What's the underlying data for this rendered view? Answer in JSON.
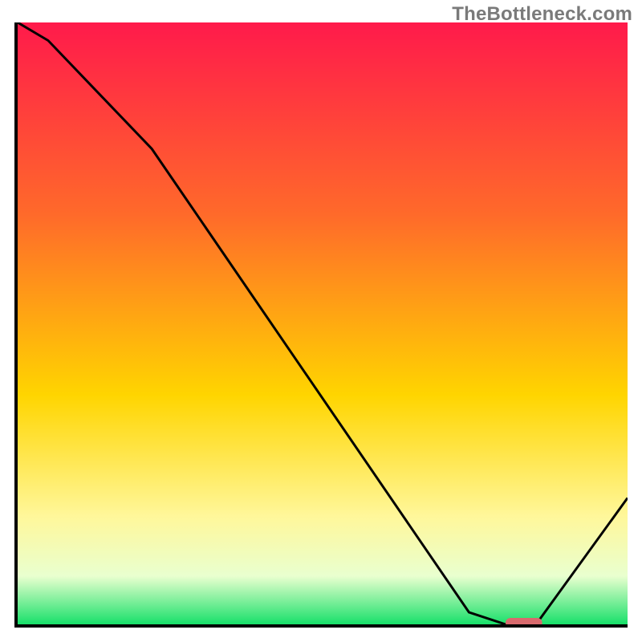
{
  "watermark": "TheBottleneck.com",
  "colors": {
    "axis": "#000000",
    "watermark": "#7a7a7a",
    "gradient_top": "#ff1a4b",
    "gradient_mid1": "#ff6a2a",
    "gradient_mid2": "#ffd500",
    "gradient_low1": "#fff79a",
    "gradient_low2": "#e9ffcf",
    "gradient_bottom": "#18e06a",
    "curve": "#000000",
    "marker": "#d86a6d"
  },
  "chart_data": {
    "type": "line",
    "title": "",
    "xlabel": "",
    "ylabel": "",
    "xlim": [
      0,
      100
    ],
    "ylim": [
      0,
      100
    ],
    "x": [
      0,
      5,
      22,
      74,
      80,
      85,
      100
    ],
    "values": [
      100,
      97,
      79,
      2,
      0,
      0,
      21
    ],
    "marker": {
      "x_start": 80,
      "x_end": 86,
      "y": 0
    },
    "notes": "vertical gradient background red→orange→yellow→green top-to-bottom; single black curve descending from top-left, flat minimum near x≈80–86 marked by a short red bar, then rising to the right"
  }
}
